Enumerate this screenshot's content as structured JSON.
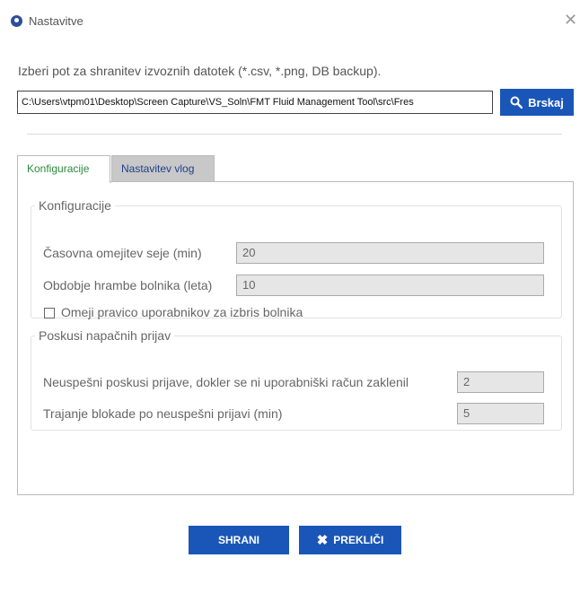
{
  "window": {
    "title": "Nastavitve",
    "close_glyph": "✕"
  },
  "export": {
    "label": "Izberi pot za shranitev izvoznih datotek (*.csv, *.png, DB backup).",
    "path_value": "C:\\Users\\vtpm01\\Desktop\\Screen Capture\\VS_Soln\\FMT Fluid Management Tool\\src\\Fres",
    "browse_label": "Brskaj",
    "browse_icon": "search-icon",
    "accent_color": "#1a56b8"
  },
  "tabs": [
    {
      "label": "Konfiguracije",
      "active": true
    },
    {
      "label": "Nastavitev vlog",
      "active": false
    }
  ],
  "configuration": {
    "legend": "Konfiguracije",
    "fields": [
      {
        "label": "Časovna omejitev seje (min)",
        "value": "20"
      },
      {
        "label": "Obdobje hrambe bolnika (leta)",
        "value": "10"
      }
    ],
    "checkbox": {
      "label": "Omeji pravico uporabnikov za izbris bolnika",
      "checked": false
    }
  },
  "login_attempts": {
    "legend": "Poskusi napačnih prijav",
    "fields": [
      {
        "label": "Neuspešni poskusi prijave, dokler se ni uporabniški račun zaklenil",
        "value": "2"
      },
      {
        "label": "Trajanje blokade po neuspešni prijavi (min)",
        "value": "5"
      }
    ]
  },
  "footer": {
    "save_label": "SHRANI",
    "cancel_label": "PREKLIČI",
    "cancel_glyph": "✖"
  }
}
